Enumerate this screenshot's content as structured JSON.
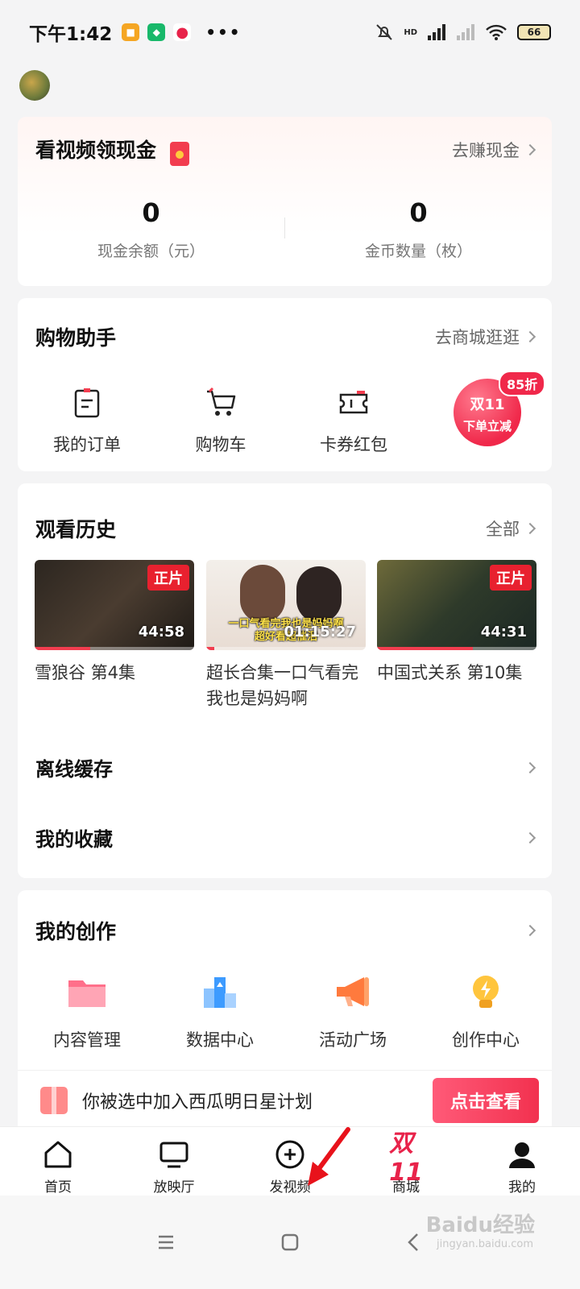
{
  "status_bar": {
    "time": "下午1:42",
    "dots": "•••",
    "network": "HD",
    "battery": "66"
  },
  "cash": {
    "title": "看视频领现金",
    "link": "去赚现金",
    "stats": [
      {
        "value": "0",
        "label": "现金余额（元）"
      },
      {
        "value": "0",
        "label": "金币数量（枚）"
      }
    ]
  },
  "shopping": {
    "title": "购物助手",
    "link": "去商城逛逛",
    "items": [
      {
        "label": "我的订单",
        "icon": "order-icon"
      },
      {
        "label": "购物车",
        "icon": "cart-icon"
      },
      {
        "label": "卡券红包",
        "icon": "coupon-icon"
      }
    ],
    "promo": {
      "line1": "双11",
      "line2": "下单立减",
      "badge": "85折"
    }
  },
  "history": {
    "title": "观看历史",
    "link": "全部",
    "videos": [
      {
        "title": "雪狼谷 第4集",
        "badge": "正片",
        "duration": "44:58",
        "progress": 0.35
      },
      {
        "title": "超长合集一口气看完我也是妈妈啊",
        "badge": "",
        "duration": "01:15:27",
        "overlay_line1": "一口气看完我也是妈妈啊",
        "overlay_line2": "超好看超催泪",
        "progress": 0.05
      },
      {
        "title": "中国式关系 第10集",
        "badge": "正片",
        "duration": "44:31",
        "progress": 0.6
      }
    ],
    "rows": [
      {
        "label": "离线缓存"
      },
      {
        "label": "我的收藏"
      }
    ]
  },
  "creation": {
    "title": "我的创作",
    "items": [
      {
        "label": "内容管理",
        "icon": "folder-icon",
        "color": "#ff6f8a"
      },
      {
        "label": "数据中心",
        "icon": "data-chart-icon",
        "color": "#3d9bff"
      },
      {
        "label": "活动广场",
        "icon": "megaphone-icon",
        "color": "#ff7a3d"
      },
      {
        "label": "创作中心",
        "icon": "lightbulb-icon",
        "color": "#ffb01f"
      }
    ]
  },
  "banner": {
    "text": "你被选中加入西瓜明日星计划",
    "button": "点击查看"
  },
  "tabbar": [
    {
      "label": "首页",
      "icon": "home-icon"
    },
    {
      "label": "放映厅",
      "icon": "tv-icon"
    },
    {
      "label": "发视频",
      "icon": "plus-circle-icon"
    },
    {
      "label": "商城",
      "icon": "mall-logo-icon",
      "logo_text": "双11"
    },
    {
      "label": "我的",
      "icon": "profile-icon"
    }
  ],
  "watermark": {
    "text": "Baidu经验",
    "sub": "jingyan.baidu.com"
  },
  "colors": {
    "accent": "#f0284a",
    "background": "#f4f4f5"
  }
}
